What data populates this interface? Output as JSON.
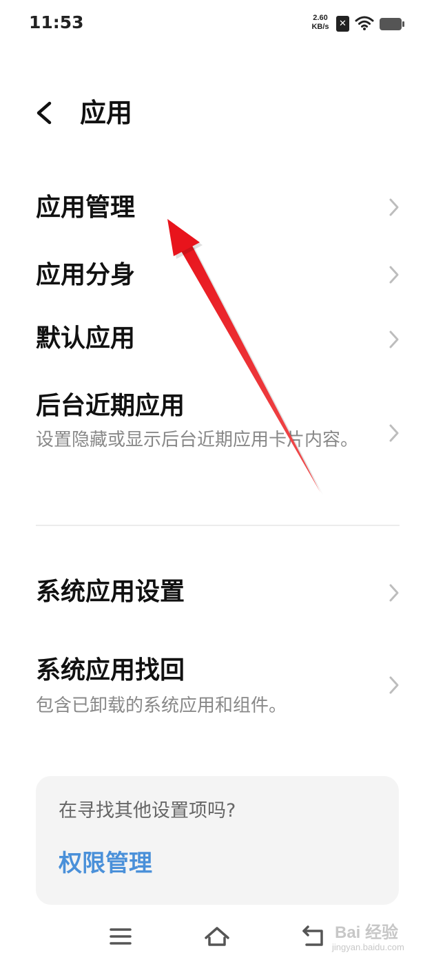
{
  "status_bar": {
    "time": "11:53",
    "net_speed_value": "2.60",
    "net_speed_unit": "KB/s",
    "sim_status": "✕",
    "icons": [
      "sim-disabled-icon",
      "wifi-icon",
      "battery-icon"
    ]
  },
  "header": {
    "back_icon": "back-arrow-icon",
    "title": "应用"
  },
  "section1": {
    "items": [
      {
        "title": "应用管理",
        "description": ""
      },
      {
        "title": "应用分身",
        "description": ""
      },
      {
        "title": "默认应用",
        "description": ""
      },
      {
        "title": "后台近期应用",
        "description": "设置隐藏或显示后台近期应用卡片内容。"
      }
    ]
  },
  "section2": {
    "items": [
      {
        "title": "系统应用设置",
        "description": ""
      },
      {
        "title": "系统应用找回",
        "description": "包含已卸载的系统应用和组件。"
      }
    ]
  },
  "suggest_card": {
    "question": "在寻找其他设置项吗?",
    "link": "权限管理"
  },
  "nav_bar": {
    "icons": [
      "menu-icon",
      "home-icon",
      "back-icon"
    ]
  },
  "watermark": {
    "brand": "Bai 经验",
    "url": "jingyan.baidu.com"
  },
  "colors": {
    "background": "#ffffff",
    "title_text": "#111111",
    "secondary_text": "#888888",
    "link_blue": "#4a90d9",
    "card_background": "#f4f4f4",
    "annotation_arrow": "#e8141c"
  }
}
